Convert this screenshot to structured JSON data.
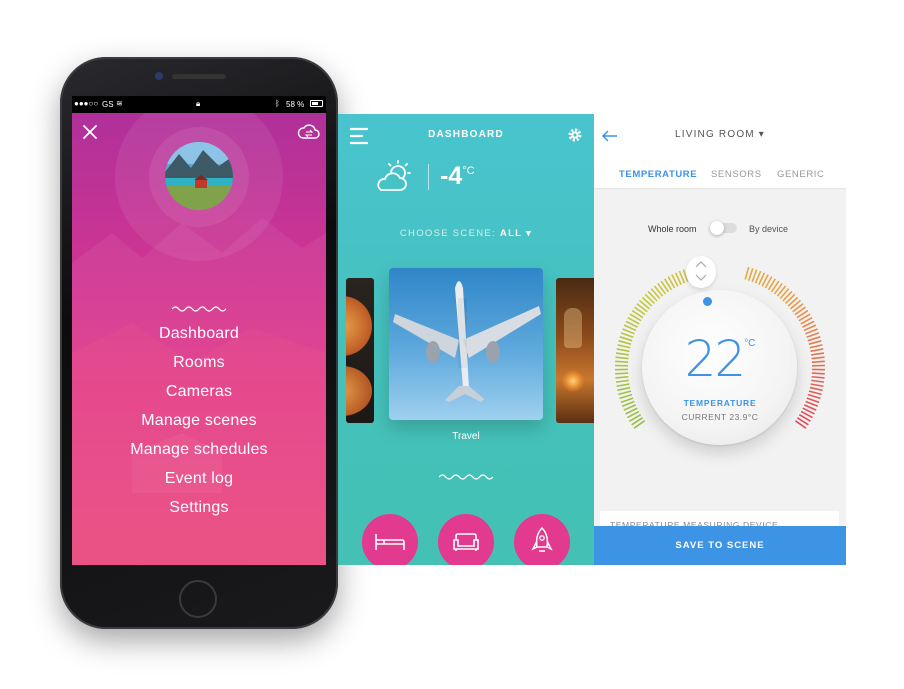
{
  "phone": {
    "status": {
      "carrier": "GS",
      "battery": "58 %",
      "battery_level": 0.58
    },
    "menu": {
      "items": [
        "Dashboard",
        "Rooms",
        "Cameras",
        "Manage scenes",
        "Manage schedules",
        "Event log",
        "Settings"
      ]
    },
    "icons": {
      "close": "close-icon",
      "cloud": "cloud-sync-icon",
      "avatar": "profile-avatar"
    }
  },
  "dashboard": {
    "title": "DASHBOARD",
    "temperature": "-4",
    "temp_unit": "°C",
    "scene_label": "CHOOSE SCENE:",
    "scene_value": "ALL ▾",
    "current_scene": "Travel",
    "icons": [
      "bed-icon",
      "sofa-icon",
      "rocket-icon"
    ]
  },
  "living": {
    "title": "LIVING ROOM ▾",
    "tabs": [
      "TEMPERATURE",
      "SENSORS",
      "GENERIC"
    ],
    "active_tab": "TEMPERATURE",
    "toggle_left": "Whole room",
    "toggle_right": "By device",
    "setpoint": "22",
    "setpoint_unit": "°C",
    "dial_label": "TEMPERATURE",
    "current": "CURRENT 23.9°C",
    "hidden_card": "TEMPERATURE MEASURING DEVICE",
    "save_label": "SAVE TO SCENE"
  },
  "colors": {
    "accent_blue": "#3d94e4",
    "teal": "#45c1bd",
    "pink": "#e13a8f",
    "magenta": "#b0309a"
  }
}
